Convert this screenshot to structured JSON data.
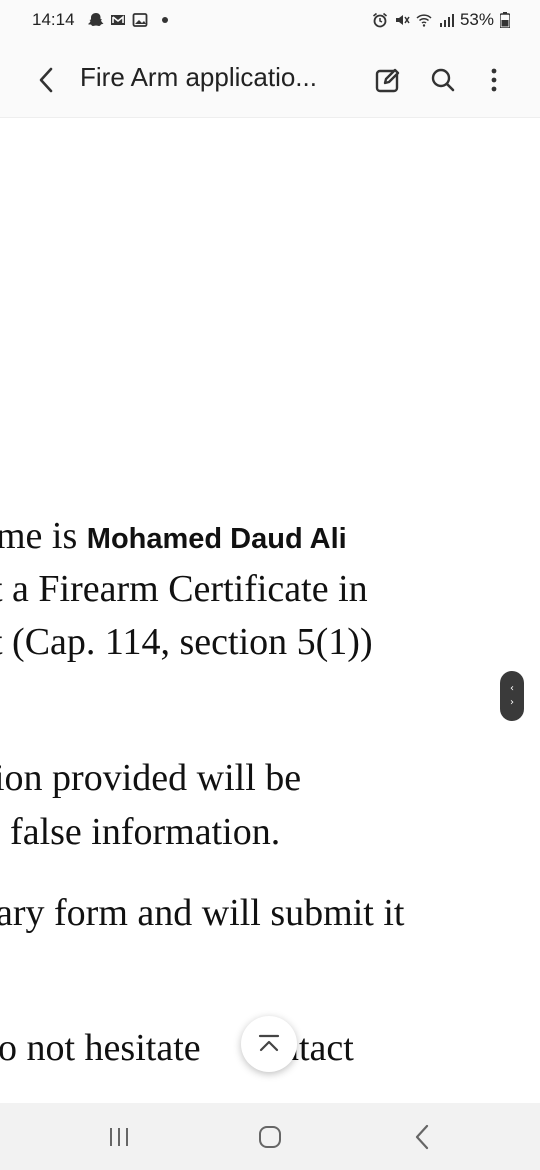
{
  "status_bar": {
    "time": "14:14",
    "battery": "53%",
    "left_icons": [
      "snapchat-icon",
      "gmail-icon",
      "gallery-icon"
    ],
    "right_icons": [
      "alarm-icon",
      "mute-icon",
      "wifi-icon",
      "signal-icon",
      "battery-icon"
    ]
  },
  "app_bar": {
    "title": "Fire Arm applicatio...",
    "back_icon": "back-arrow-icon",
    "edit_icon": "edit-icon",
    "search_icon": "search-icon",
    "more_icon": "more-vert-icon"
  },
  "document": {
    "line1_prefix": "me is ",
    "line1_name": "Mohamed Daud Ali",
    "line2": "t a Firearm Certificate in",
    "line3": "t (Cap. 114, section 5(1))",
    "line4": "ion provided will be",
    "line5": "; false information.",
    "line6": "ary form and will submit it",
    "line7": "o not hesitate ",
    "line7_end": "contact"
  },
  "nav_bar": {
    "items": [
      "recents-icon",
      "home-icon",
      "back-icon"
    ]
  }
}
